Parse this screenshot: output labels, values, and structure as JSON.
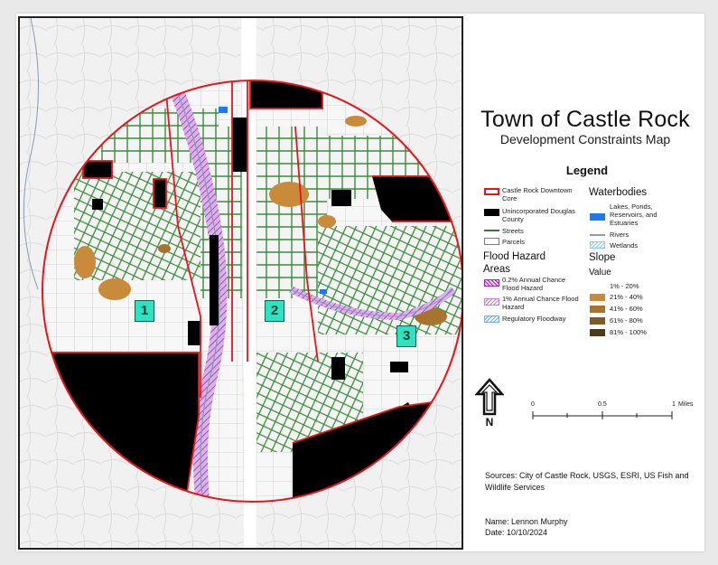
{
  "title": "Town of Castle Rock",
  "subtitle": "Development Constraints Map",
  "legend": {
    "title": "Legend",
    "items": [
      {
        "label": "Castle Rock Downtown Core",
        "symbol": "red-outline-box",
        "color": "#e8141b"
      },
      {
        "label": "Unincorporated Douglas County",
        "symbol": "black-fill-box",
        "color": "#000000"
      },
      {
        "label": "Streets",
        "symbol": "green-line",
        "color": "#2e7d32"
      },
      {
        "label": "Parcels",
        "symbol": "gray-outline-box",
        "color": "#7a7a7a"
      }
    ],
    "flood_heading": "Flood Hazard Areas",
    "flood_items": [
      {
        "label": "0.2% Annual Chance Flood Hazard",
        "symbol": "purple-crosshatch",
        "color": "#9c27b0"
      },
      {
        "label": "1% Annual Chance Flood Hazard",
        "symbol": "purple-diagonal",
        "color": "#c77dd6"
      },
      {
        "label": "Regulatory Floodway",
        "symbol": "blue-diagonal",
        "color": "#7ea7e0"
      }
    ],
    "water_heading": "Waterbodies",
    "water_items": [
      {
        "label": "Lakes, Ponds, Reservoirs, and Estuaries",
        "symbol": "blue-fill",
        "color": "#1f78f0"
      },
      {
        "label": "Rivers",
        "symbol": "river-line",
        "color": "#8a9bbf"
      },
      {
        "label": "Wetlands",
        "symbol": "wetland-hatch",
        "color": "#7fd3e8"
      }
    ],
    "slope_heading": "Slope",
    "slope_value_label": "Value",
    "slope_items": [
      {
        "label": "1% - 20%",
        "color": "#ffffff"
      },
      {
        "label": "21% - 40%",
        "color": "#c98a3a"
      },
      {
        "label": "41% - 60%",
        "color": "#a7742e"
      },
      {
        "label": "61% - 80%",
        "color": "#7e5a26"
      },
      {
        "label": "81% - 100%",
        "color": "#4f3a17"
      }
    ]
  },
  "scale_bar": {
    "ticks": [
      "0",
      "0.5",
      "1"
    ],
    "unit": "Miles"
  },
  "north_arrow_letter": "N",
  "zones": [
    {
      "label": "1"
    },
    {
      "label": "2"
    },
    {
      "label": "3"
    }
  ],
  "sources": "Sources: City of Castle Rock, USGS, ESRI, US Fish and Wildlife Services",
  "author": "Name: Lennon Murphy",
  "date": "Date: 10/10/2024"
}
